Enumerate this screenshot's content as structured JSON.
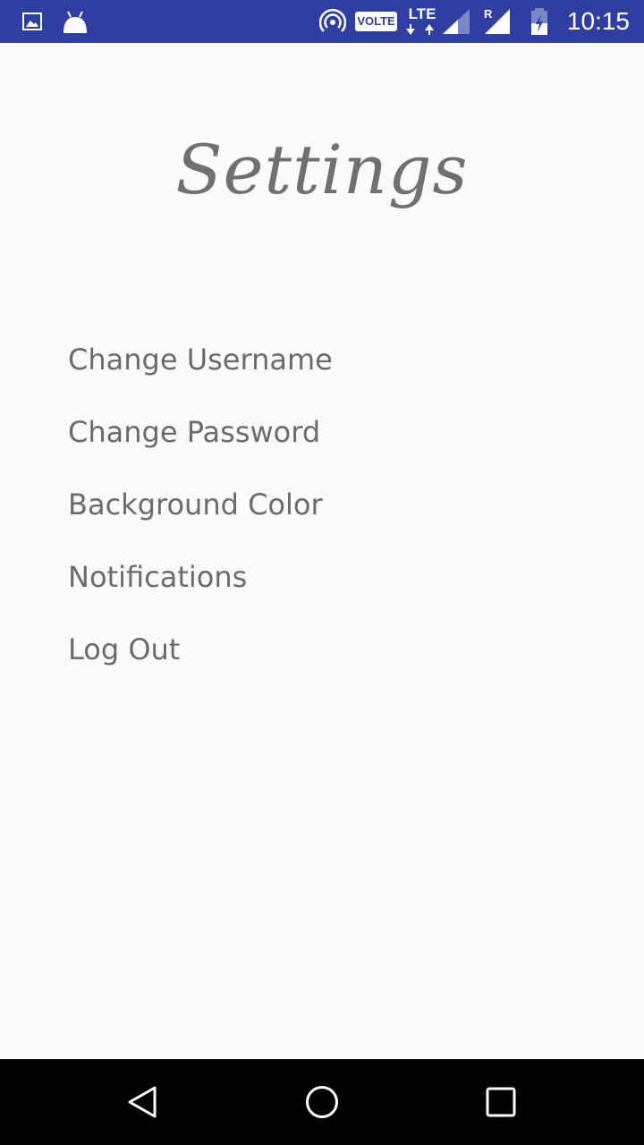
{
  "status_bar": {
    "time": "10:15",
    "volte_label": "VOLTE",
    "network_type": "LTE",
    "roaming_indicator": "R",
    "icons": [
      "gallery-notification-icon",
      "android-notification-icon",
      "hotspot-icon",
      "volte-icon",
      "lte-data-icon",
      "signal-icon",
      "roaming-signal-icon",
      "battery-icon"
    ]
  },
  "page": {
    "title": "Settings"
  },
  "menu": {
    "items": [
      {
        "label": "Change Username"
      },
      {
        "label": "Change Password"
      },
      {
        "label": "Background Color"
      },
      {
        "label": "Notifications"
      },
      {
        "label": "Log Out"
      }
    ]
  },
  "nav_bar": {
    "icons": [
      "back-icon",
      "home-icon",
      "recents-icon"
    ]
  },
  "colors": {
    "status_bar": "#303f9f",
    "background": "#fafafa",
    "text": "#6b6b6b",
    "title": "#707070",
    "nav_bar": "#000000"
  }
}
